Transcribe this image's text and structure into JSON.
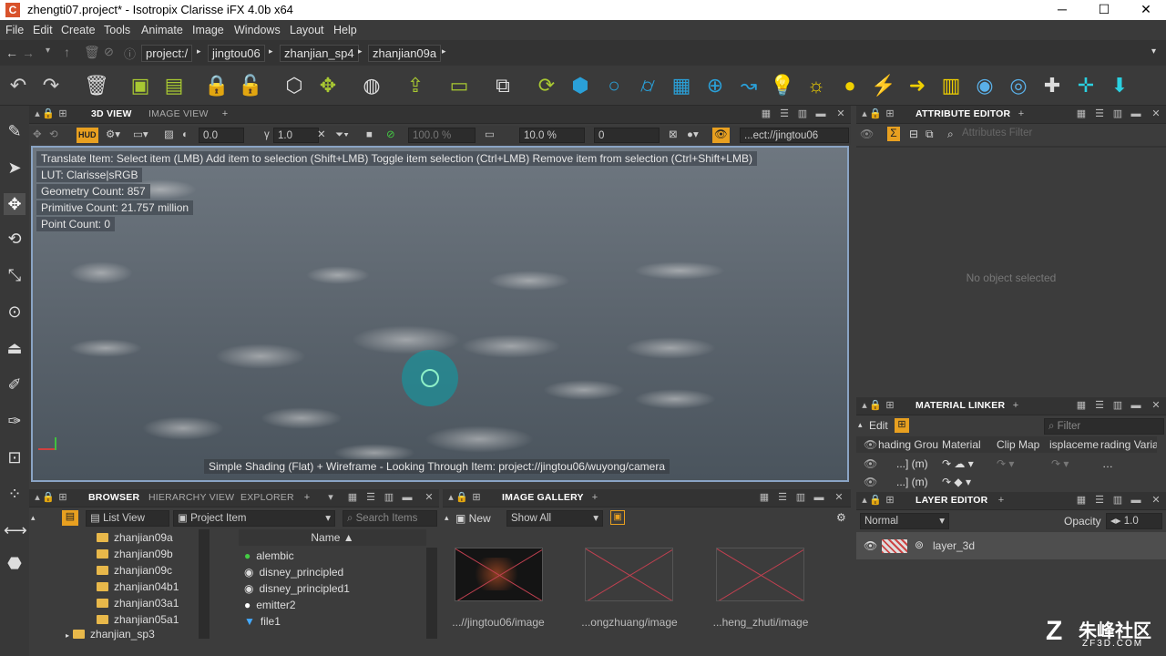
{
  "window": {
    "title": "zhengti07.project* - Isotropix Clarisse iFX 4.0b x64",
    "minimize": "─",
    "maximize": "☐",
    "close": "✕"
  },
  "menu": [
    "File",
    "Edit",
    "Create",
    "Tools",
    "Animate",
    "Image",
    "Windows",
    "Layout",
    "Help"
  ],
  "breadcrumb": [
    "project:/",
    "jingtou06",
    "zhanjian_sp4",
    "zhanjian09a"
  ],
  "viewport": {
    "tabs": [
      "3D VIEW",
      "IMAGE VIEW"
    ],
    "hud": "HUD",
    "field1": "0.0",
    "field2": "1.0",
    "zoom": "100.0 %",
    "pct": "10.0 %",
    "field3": "0",
    "path": "...ect://jingtou06",
    "info": [
      "Translate Item: Select item (LMB)  Add item to selection (Shift+LMB)  Toggle item selection (Ctrl+LMB)  Remove item from selection (Ctrl+Shift+LMB)",
      "LUT: Clarisse|sRGB",
      "Geometry Count: 857",
      "Primitive Count: 21.757 million",
      "Point Count: 0"
    ],
    "status": "Simple Shading (Flat) + Wireframe - Looking Through Item: project://jingtou06/wuyong/camera"
  },
  "attribute_editor": {
    "title": "ATTRIBUTE EDITOR",
    "filter": "Attributes Filter",
    "empty": "No object selected"
  },
  "material_linker": {
    "title": "MATERIAL LINKER",
    "edit": "Edit",
    "filter": "Filter",
    "columns": [
      "hading Grou",
      "Material",
      "Clip Map",
      "isplaceme",
      "rading Varial"
    ],
    "rows": [
      "...] (m)",
      "...] (m)"
    ]
  },
  "layer_editor": {
    "title": "LAYER EDITOR",
    "mode": "Normal",
    "opacity_label": "Opacity",
    "opacity": "1.0",
    "layer": "layer_3d"
  },
  "browser": {
    "tabs": [
      "BROWSER",
      "HIERARCHY VIEW",
      "EXPLORER"
    ],
    "view": "List View",
    "type": "Project Item",
    "search": "Search Items",
    "name_col": "Name ▲",
    "folders": [
      "zhanjian09a",
      "zhanjian09b",
      "zhanjian09c",
      "zhanjian04b1",
      "zhanjian03a1",
      "zhanjian05a1",
      "zhanjian_sp3"
    ],
    "items": [
      "alembic",
      "disney_principled",
      "disney_principled1",
      "emitter2",
      "file1"
    ]
  },
  "gallery": {
    "title": "IMAGE GALLERY",
    "new": "New",
    "show": "Show All",
    "images": [
      "...//jingtou06/image",
      "...ongzhuang/image",
      "...heng_zhuti/image"
    ]
  },
  "watermark": {
    "text": "朱峰社区",
    "sub": "ZF3D.COM"
  }
}
